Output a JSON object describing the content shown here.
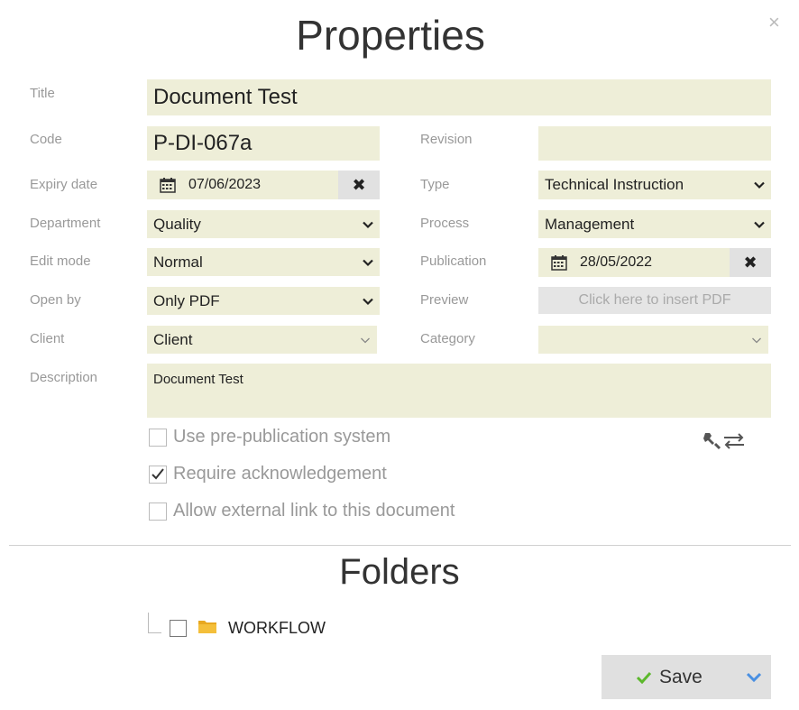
{
  "dialog": {
    "title": "Properties",
    "close_glyph": "×"
  },
  "labels": {
    "title": "Title",
    "code": "Code",
    "revision": "Revision",
    "expiry_date": "Expiry date",
    "type": "Type",
    "department": "Department",
    "process": "Process",
    "edit_mode": "Edit mode",
    "publication": "Publication",
    "open_by": "Open by",
    "preview": "Preview",
    "client": "Client",
    "category": "Category",
    "description": "Description"
  },
  "fields": {
    "title": "Document Test",
    "code": "P-DI-067a",
    "revision": "",
    "expiry_date": "07/06/2023",
    "type": "Technical Instruction",
    "department": "Quality",
    "process": "Management",
    "edit_mode": "Normal",
    "publication": "28/05/2022",
    "open_by": "Only PDF",
    "preview_button": "Click here to insert PDF",
    "client": "Client",
    "category": "",
    "description": "Document Test"
  },
  "checkboxes": [
    {
      "label": "Use pre-publication system",
      "checked": false
    },
    {
      "label": "Require acknowledgement",
      "checked": true
    },
    {
      "label": "Allow external link to this document",
      "checked": false
    }
  ],
  "folders": {
    "title": "Folders",
    "items": [
      {
        "name": "WORKFLOW",
        "checked": false
      }
    ]
  },
  "actions": {
    "save_label": "Save"
  },
  "icons": {
    "calendar": "calendar-icon",
    "clear": "clear-icon",
    "chevron": "chevron-down-icon",
    "tools": "wrench-swap-icon",
    "folder": "folder-icon",
    "check": "check-icon",
    "close": "close-icon"
  },
  "colors": {
    "field_bg": "#eeeed8",
    "button_bg": "#e0e0e0",
    "save_check": "#5cb82c",
    "dropdown_chevron": "#4a90e2",
    "folder": "#e8a820"
  }
}
